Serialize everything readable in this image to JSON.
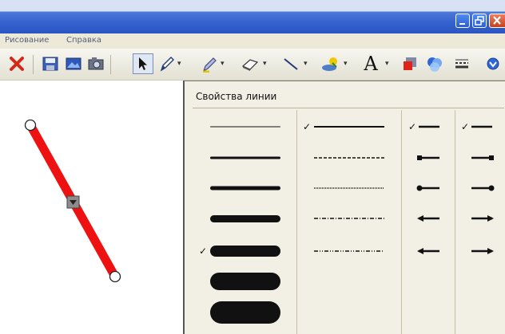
{
  "window": {
    "buttons": [
      "minimize",
      "maximize",
      "close"
    ]
  },
  "menu": {
    "items": [
      "Рисование",
      "Справка"
    ]
  },
  "toolbar": {
    "icons": [
      "delete-icon",
      "save-icon",
      "image-icon",
      "camera-icon",
      "pointer-icon",
      "pen-icon",
      "highlighter-icon",
      "eraser-icon",
      "line-icon",
      "fill-icon",
      "text-icon",
      "shape-icon",
      "color-icon",
      "line-style-icon",
      "more-icon"
    ],
    "text_tool_label": "A"
  },
  "line_panel": {
    "title": "Свойства линии",
    "thickness": {
      "options": [
        1,
        3,
        5,
        9,
        14,
        22,
        28
      ],
      "selected_index": 4
    },
    "dash": {
      "options": [
        "solid",
        "dashed",
        "dotted",
        "dash-dot",
        "dash-dot-dot"
      ],
      "selected_index": 0
    },
    "start_cap": {
      "options": [
        "none",
        "square",
        "circle",
        "arrow",
        "arrow"
      ],
      "selected_index": 0
    },
    "end_cap": {
      "options": [
        "none",
        "square",
        "circle",
        "arrow",
        "arrow"
      ],
      "selected_index": 0
    },
    "check_mark": "✓"
  },
  "canvas": {
    "line_color": "#ee1111"
  }
}
